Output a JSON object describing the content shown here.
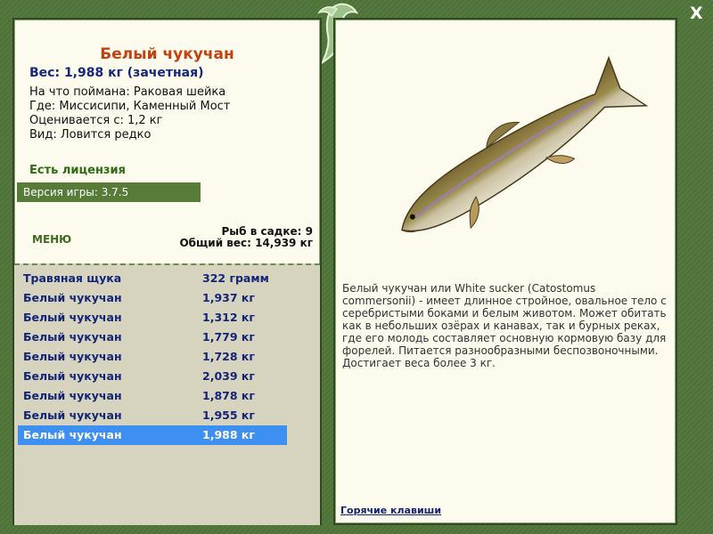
{
  "window": {
    "close_label": "X"
  },
  "fish": {
    "name": "Белый чукучан",
    "weight": "Вес: 1,988 кг (зачетная)",
    "bait": "На что поймана: Раковая шейка",
    "location": "Где: Миссисипи, Каменный Мост",
    "valued_from": "Оценивается с: 1,2 кг",
    "rarity": "Вид: Ловится редко"
  },
  "license": "Есть лицензия",
  "version": "Версия игры: 3.7.5",
  "menu_label": "МЕНЮ",
  "keepnet": {
    "count": "Рыб в садке: 9",
    "total": "Общий вес: 14,939 кг"
  },
  "catch_list": [
    {
      "name": "Травяная щука",
      "weight": "322 грамм"
    },
    {
      "name": "Белый чукучан",
      "weight": "1,937 кг"
    },
    {
      "name": "Белый чукучан",
      "weight": "1,312 кг"
    },
    {
      "name": "Белый чукучан",
      "weight": "1,779 кг"
    },
    {
      "name": "Белый чукучан",
      "weight": "1,728 кг"
    },
    {
      "name": "Белый чукучан",
      "weight": "2,039 кг"
    },
    {
      "name": "Белый чукучан",
      "weight": "1,878 кг"
    },
    {
      "name": "Белый чукучан",
      "weight": "1,955 кг"
    },
    {
      "name": "Белый чукучан",
      "weight": "1,988 кг"
    }
  ],
  "selected_index": 8,
  "description": "Белый чукучан или White sucker (Catostomus commersonii) - имеет длинное стройное, овальное тело с серебристыми боками и белым животом. Может обитать как в небольших озёрах и канавах, так и бурных реках, где его молодь составляет основную кормовую базу для форелей. Питается разнообразными беспозвоночными. Достигает веса более 3 кг.",
  "hotkeys_label": "Горячие клавиши",
  "colors": {
    "frame": "#4d7236",
    "panel": "#fcfbee",
    "list_bg": "#d6d4be",
    "selected": "#3d8ff2",
    "title": "#c2410f",
    "text_blue": "#142578"
  },
  "icons": {
    "ornament": "fish-ornament-icon",
    "fish_image": "white-sucker-fish"
  }
}
